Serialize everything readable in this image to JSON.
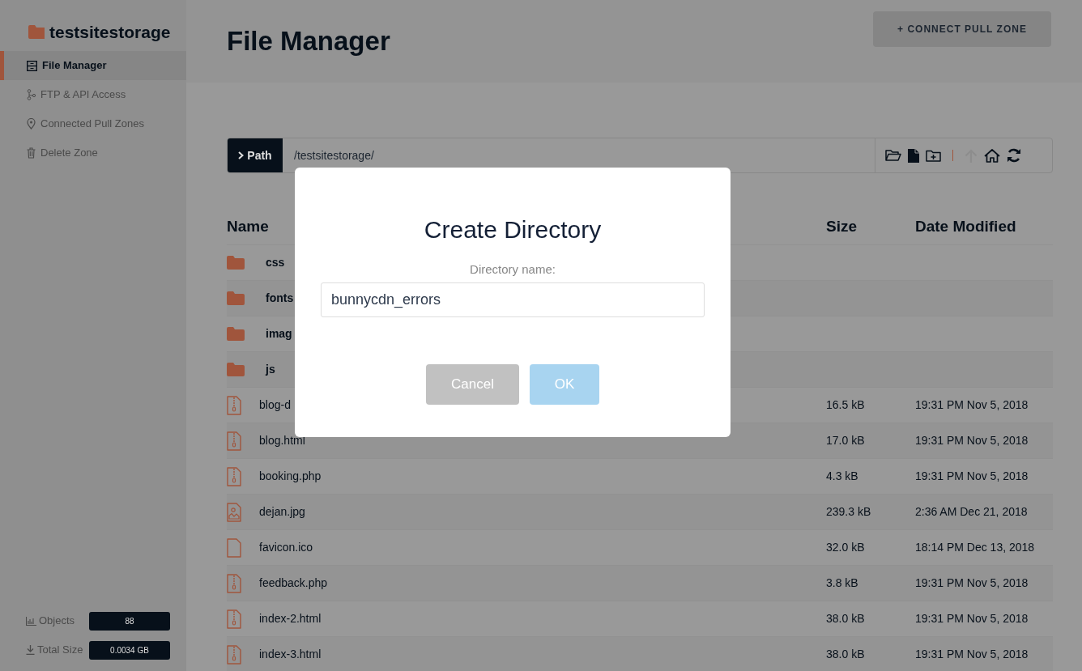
{
  "sidebar": {
    "zone_name": "testsitestorage",
    "items": [
      {
        "label": "File Manager",
        "kind": "cabinet",
        "selected": true
      },
      {
        "label": "FTP & API Access",
        "kind": "branch",
        "selected": false
      },
      {
        "label": "Connected Pull Zones",
        "kind": "pin",
        "selected": false
      },
      {
        "label": "Delete Zone",
        "kind": "trash",
        "selected": false
      }
    ],
    "stats": [
      {
        "label": "Objects",
        "kind": "chart",
        "value": "88"
      },
      {
        "label": "Total Size",
        "kind": "download",
        "value": "0.0034 GB"
      }
    ]
  },
  "header": {
    "title": "File Manager",
    "action": "+ CONNECT PULL ZONE"
  },
  "path_bar": {
    "button": "Path",
    "value": "/testsitestorage/",
    "tools": [
      {
        "kind": "open-folder",
        "disabled": false
      },
      {
        "kind": "file",
        "disabled": false
      },
      {
        "kind": "new-folder",
        "disabled": false
      },
      {
        "kind": "separator"
      },
      {
        "kind": "up",
        "disabled": true
      },
      {
        "kind": "home",
        "disabled": false
      },
      {
        "kind": "refresh",
        "disabled": false
      }
    ]
  },
  "table": {
    "columns": [
      "Name",
      "Size",
      "Date Modified"
    ],
    "rows": [
      {
        "kind": "folder",
        "name": "css",
        "size": "",
        "date": ""
      },
      {
        "kind": "folder",
        "name": "fonts",
        "size": "",
        "date": ""
      },
      {
        "kind": "folder",
        "name": "imag",
        "size": "",
        "date": ""
      },
      {
        "kind": "folder",
        "name": "js",
        "size": "",
        "date": ""
      },
      {
        "kind": "archive",
        "name": "blog-d",
        "size": "16.5 kB",
        "date": "19:31 PM Nov 5, 2018"
      },
      {
        "kind": "archive",
        "name": "blog.html",
        "size": "17.0 kB",
        "date": "19:31 PM Nov 5, 2018"
      },
      {
        "kind": "archive",
        "name": "booking.php",
        "size": "4.3 kB",
        "date": "19:31 PM Nov 5, 2018"
      },
      {
        "kind": "image",
        "name": "dejan.jpg",
        "size": "239.3 kB",
        "date": "2:36 AM Dec 21, 2018"
      },
      {
        "kind": "blank",
        "name": "favicon.ico",
        "size": "32.0 kB",
        "date": "18:14 PM Dec 13, 2018"
      },
      {
        "kind": "archive",
        "name": "feedback.php",
        "size": "3.8 kB",
        "date": "19:31 PM Nov 5, 2018"
      },
      {
        "kind": "archive",
        "name": "index-2.html",
        "size": "38.0 kB",
        "date": "19:31 PM Nov 5, 2018"
      },
      {
        "kind": "archive",
        "name": "index-3.html",
        "size": "38.0 kB",
        "date": "19:31 PM Nov 5, 2018"
      }
    ]
  },
  "dialog": {
    "title": "Create Directory",
    "label": "Directory name:",
    "value": "bunnycdn_errors",
    "buttons": [
      {
        "kind": "cancel",
        "label": "Cancel"
      },
      {
        "kind": "ok",
        "label": "OK"
      }
    ]
  }
}
